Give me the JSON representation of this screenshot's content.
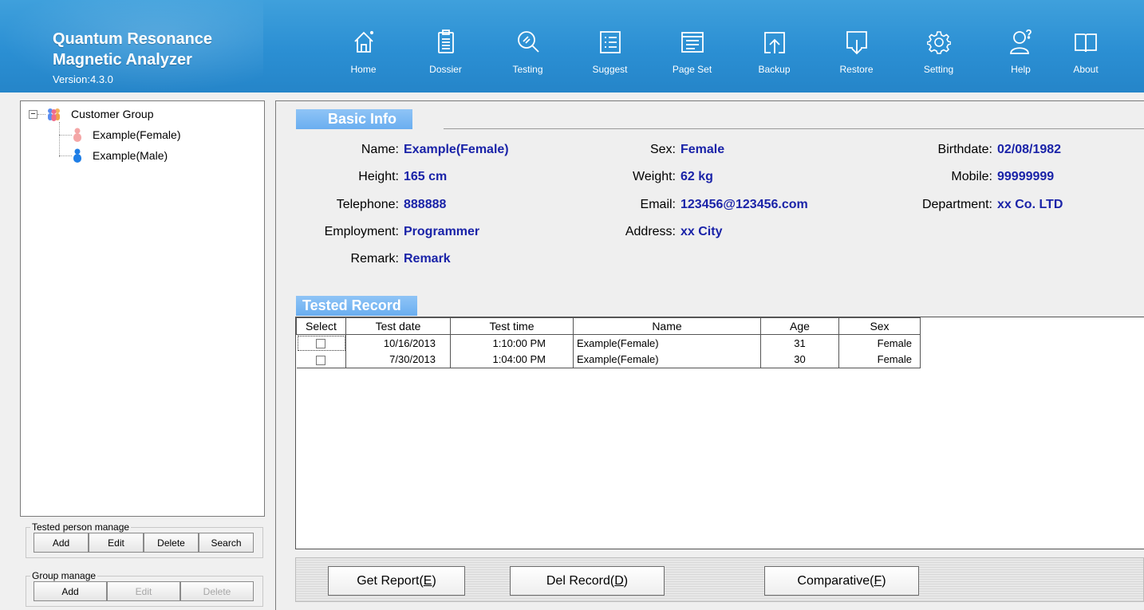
{
  "app": {
    "title_line1": "Quantum Resonance",
    "title_line2": "Magnetic Analyzer",
    "version": "Version:4.3.0"
  },
  "nav": [
    {
      "label": "Home",
      "icon": "home-icon"
    },
    {
      "label": "Dossier",
      "icon": "clipboard-icon"
    },
    {
      "label": "Testing",
      "icon": "magnifier-icon"
    },
    {
      "label": "Suggest",
      "icon": "list-icon"
    },
    {
      "label": "Page Set",
      "icon": "window-icon"
    },
    {
      "label": "Backup",
      "icon": "upload-icon"
    },
    {
      "label": "Restore",
      "icon": "download-icon"
    },
    {
      "label": "Setting",
      "icon": "gear-icon"
    },
    {
      "label": "Help",
      "icon": "help-user-icon"
    },
    {
      "label": "About",
      "icon": "book-icon"
    }
  ],
  "tree": {
    "root": "Customer Group",
    "expander": "−",
    "children": [
      "Example(Female)",
      "Example(Male)"
    ]
  },
  "person_manage": {
    "legend": "Tested person manage",
    "add": "Add",
    "edit": "Edit",
    "delete": "Delete",
    "search": "Search"
  },
  "group_manage": {
    "legend": "Group manage",
    "add": "Add",
    "edit": "Edit",
    "delete": "Delete"
  },
  "basic_info": {
    "title": "Basic Info",
    "name_label": "Name:",
    "name": "Example(Female)",
    "sex_label": "Sex:",
    "sex": "Female",
    "birthdate_label": "Birthdate:",
    "birthdate": "02/08/1982",
    "height_label": "Height:",
    "height": "165 cm",
    "weight_label": "Weight:",
    "weight": "62 kg",
    "mobile_label": "Mobile:",
    "mobile": "99999999",
    "telephone_label": "Telephone:",
    "telephone": "888888",
    "email_label": "Email:",
    "email": "123456@123456.com",
    "department_label": "Department:",
    "department": "xx Co. LTD",
    "employment_label": "Employment:",
    "employment": "Programmer",
    "address_label": "Address:",
    "address": "xx City",
    "remark_label": "Remark:",
    "remark": "Remark"
  },
  "tested_record": {
    "title": "Tested Record",
    "columns": [
      "Select",
      "Test date",
      "Test time",
      "Name",
      "Age",
      "Sex"
    ],
    "rows": [
      {
        "date": "10/16/2013",
        "time": "1:10:00 PM",
        "name": "Example(Female)",
        "age": "31",
        "sex": "Female"
      },
      {
        "date": "7/30/2013",
        "time": "1:04:00 PM",
        "name": "Example(Female)",
        "age": "30",
        "sex": "Female"
      }
    ]
  },
  "actions": {
    "get_report": "Get Report(",
    "get_report_key": "E",
    "del_record": "Del Record(",
    "del_record_key": "D",
    "comparative": "Comparative(",
    "comparative_key": "F",
    "close": ")"
  },
  "colors": {
    "header": "#2b8fd3",
    "section_tab": "#7ab8f3",
    "value_text": "#1a23a8"
  }
}
